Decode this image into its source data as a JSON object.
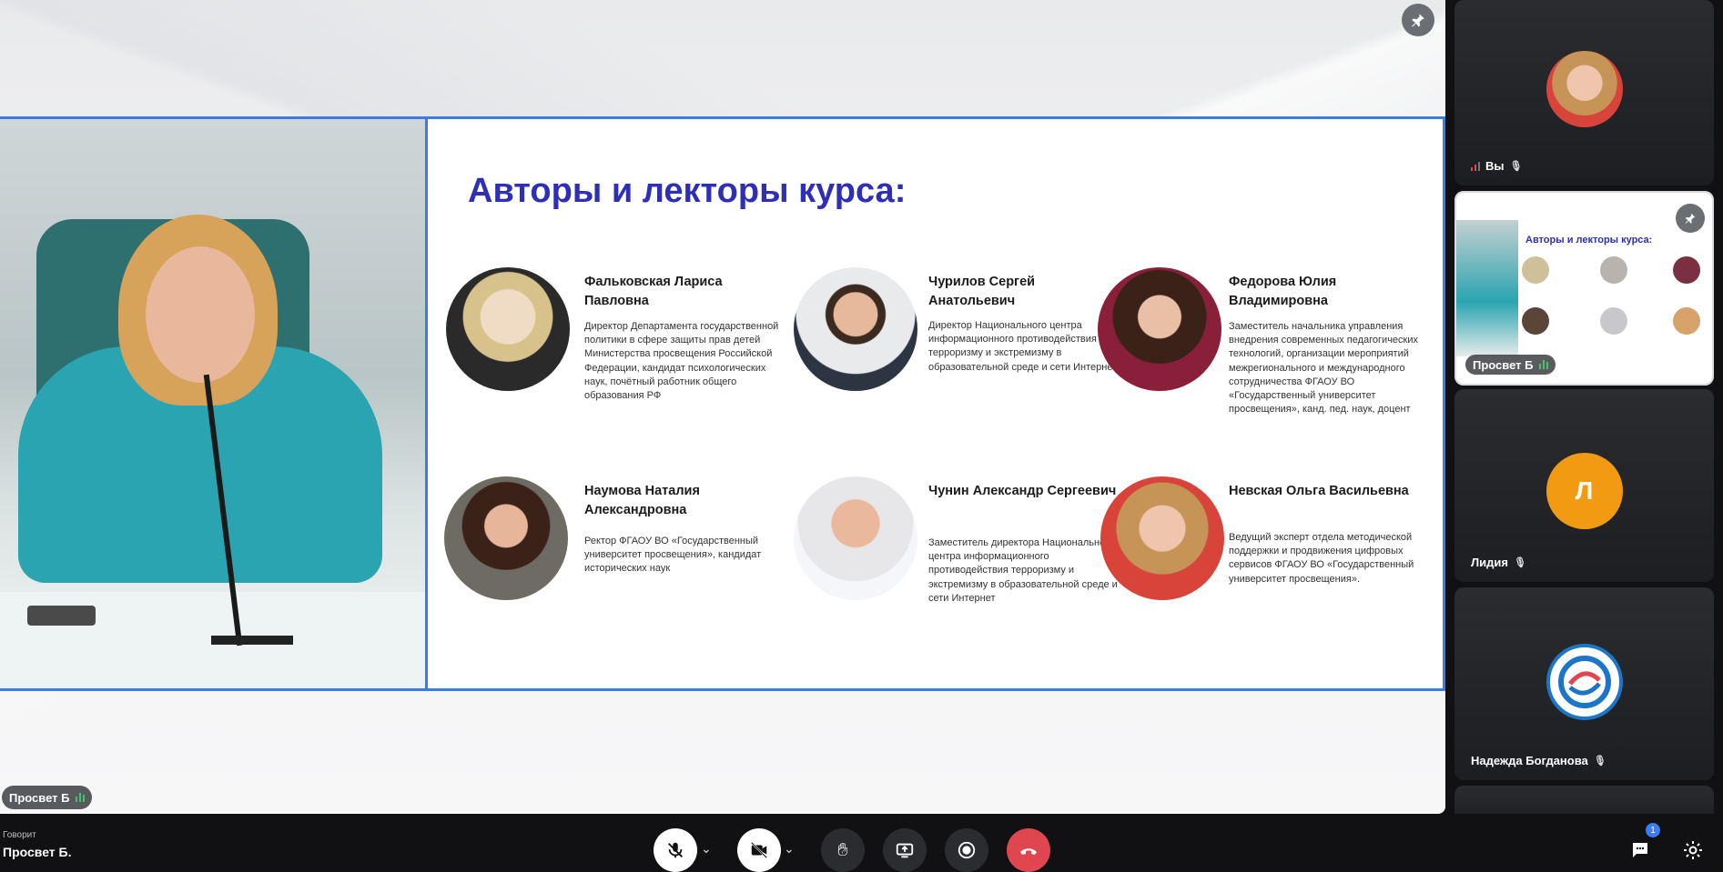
{
  "stage": {
    "speaker_label": "Просвет Б",
    "slide": {
      "title": "Авторы и лекторы курса:",
      "lecturers": [
        {
          "name": "Фальковская Лариса Павловна",
          "description": "Директор Департамента государственной политики в сфере защиты прав детей Министерства просвещения Российской Федерации, кандидат психологических наук, почётный работник общего образования РФ"
        },
        {
          "name": "Чурилов Сергей Анатольевич",
          "description": "Директор Национального центра информационного противодействия терроризму и экстремизму в образовательной среде и сети Интернет"
        },
        {
          "name": "Федорова Юлия Владимировна",
          "description": "Заместитель начальника управления внедрения современных педагогических технологий, организации мероприятий межрегионального и международного сотрудничества ФГАОУ ВО «Государственный университет просвещения», канд. пед. наук, доцент"
        },
        {
          "name": "Наумова Наталия Александровна",
          "description": "Ректор ФГАОУ ВО «Государственный университет просвещения», кандидат исторических наук"
        },
        {
          "name": "Чунин Александр Сергеевич",
          "description": "Заместитель директора Национального центра информационного противодействия терроризму и экстремизму в образовательной среде и сети Интернет"
        },
        {
          "name": "Невская Ольга Васильевна",
          "description": "Ведущий эксперт отдела методической поддержки и продвижения цифровых сервисов ФГАОУ ВО «Государственный университет просвещения»."
        }
      ]
    }
  },
  "participants": [
    {
      "name": "Вы",
      "muted": true
    },
    {
      "name": "Просвет Б",
      "mini_title": "Авторы и лекторы курса:"
    },
    {
      "name": "Лидия",
      "initial": "Л",
      "muted": true
    },
    {
      "name": "Надежда Богданова",
      "muted": true
    }
  ],
  "bottombar": {
    "talking_caption": "Говорит",
    "talking_name": "Просвет Б.",
    "chat_badge": "1"
  },
  "colors": {
    "accent_blue": "#3b7be8",
    "slide_title": "#2f2fb6",
    "hangup_red": "#e0464f",
    "lidia_avatar": "#f29a12"
  },
  "icons": [
    "pin-icon",
    "mic-off-icon",
    "camera-off-icon",
    "raise-hand-icon",
    "screen-share-icon",
    "record-icon",
    "hang-up-icon",
    "chat-icon",
    "settings-icon"
  ]
}
